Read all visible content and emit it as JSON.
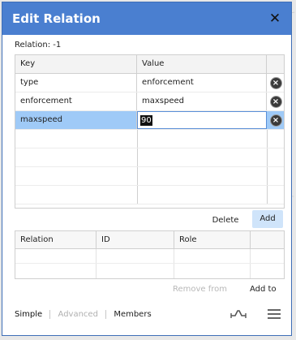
{
  "dialog": {
    "title": "Edit Relation",
    "close_glyph": "✕",
    "relation_label": "Relation: -1"
  },
  "tags": {
    "headers": {
      "key": "Key",
      "value": "Value"
    },
    "rows": [
      {
        "key": "type",
        "value": "enforcement"
      },
      {
        "key": "enforcement",
        "value": "maxspeed"
      },
      {
        "key": "maxspeed",
        "value": "90",
        "selected": true,
        "editing": true
      }
    ],
    "delete_icon": "close-circle-icon"
  },
  "tag_actions": {
    "delete_label": "Delete",
    "add_label": "Add"
  },
  "members": {
    "headers": {
      "relation": "Relation",
      "id": "ID",
      "role": "Role"
    }
  },
  "member_actions": {
    "remove_from_label": "Remove from",
    "add_to_label": "Add to"
  },
  "footer": {
    "tabs": [
      {
        "label": "Simple",
        "state": "active"
      },
      {
        "label": "Advanced",
        "state": "disabled"
      },
      {
        "label": "Members",
        "state": "normal"
      }
    ],
    "icons": [
      "route-icon",
      "menu-icon"
    ]
  },
  "colors": {
    "titlebar": "#4a7fd0",
    "selected_row": "#9fcaf7",
    "add_button": "#cfe4fa"
  }
}
